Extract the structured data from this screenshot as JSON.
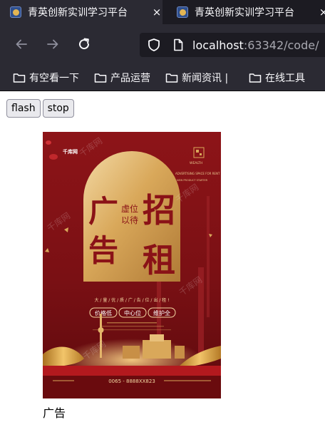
{
  "browser": {
    "tabs": [
      {
        "title": "青英创新实训学习平台",
        "close": "×"
      },
      {
        "title": "青英创新实训学习平台",
        "close": "×"
      }
    ],
    "url": {
      "host": "localhost",
      "rest": ":63342/code/"
    },
    "bookmarks": [
      "有空看一下",
      "产品运营",
      "新闻资讯 |",
      "在线工具"
    ]
  },
  "page": {
    "buttons": {
      "flash": "flash",
      "stop": "stop"
    },
    "caption": "广告"
  },
  "poster": {
    "logo": "千库网",
    "wealth": "WEALTH",
    "advertising": "ADVERTISING SPACE FOR RENT",
    "new_product": "NEW PRODUCT STARTER",
    "big_left_top": "广",
    "big_left_bottom": "告",
    "big_right_top": "招",
    "big_right_bottom": "租",
    "small_top": "虚位",
    "small_bottom": "以待",
    "slogan": "大 / 量 / 优 / 质 / 广 / 告 / 位 / 出 / 租 !",
    "tags": [
      "价格低",
      "中心位",
      "维护全"
    ],
    "phone": "0065 - 8888XX823",
    "watermark": "千库网",
    "colors": {
      "bg": "#8d1418",
      "gold": "#d9a85a",
      "text_red": "#8a1217"
    }
  }
}
